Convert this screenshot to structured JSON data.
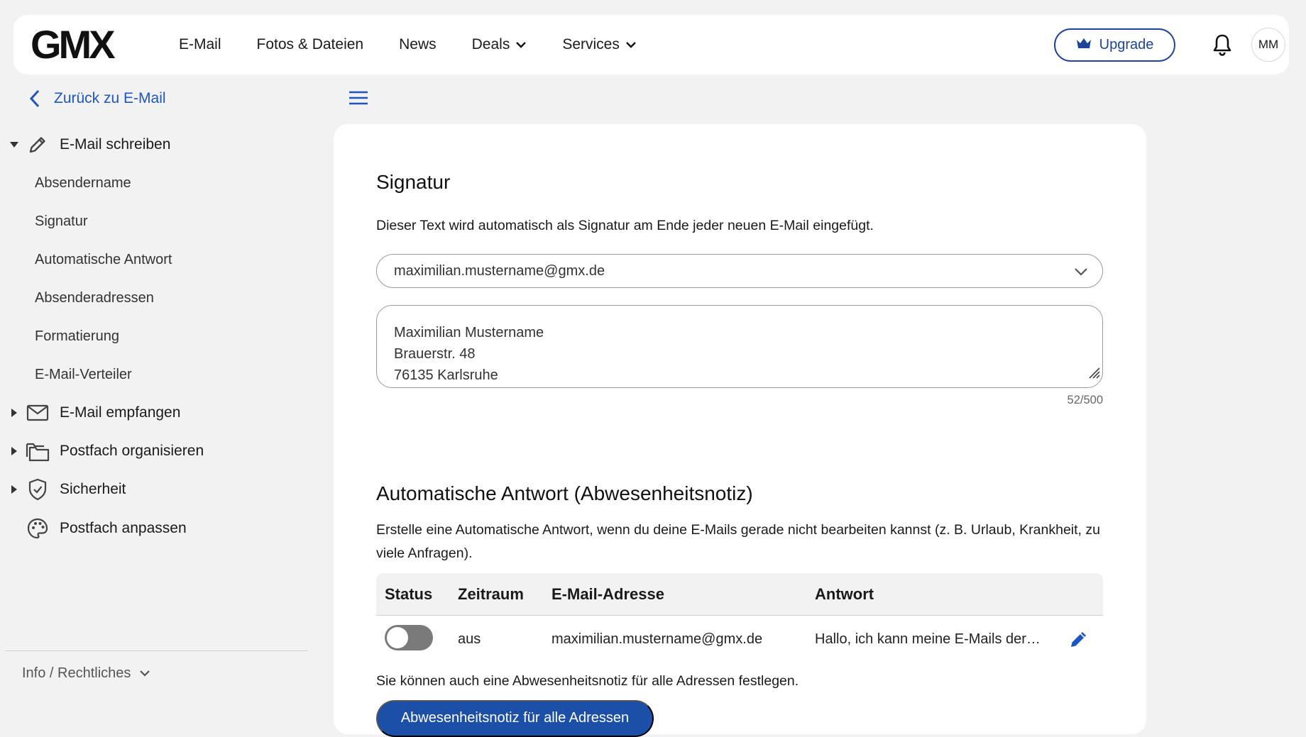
{
  "brand": {
    "logo_text": "GMX",
    "accent": "#1c449b"
  },
  "header": {
    "nav": [
      {
        "label": "E-Mail",
        "dropdown": false
      },
      {
        "label": "Fotos & Dateien",
        "dropdown": false
      },
      {
        "label": "News",
        "dropdown": false
      },
      {
        "label": "Deals",
        "dropdown": true
      },
      {
        "label": "Services",
        "dropdown": true
      }
    ],
    "upgrade_label": "Upgrade",
    "avatar_initials": "MM"
  },
  "sidebar": {
    "back_label": "Zurück zu E-Mail",
    "groups": [
      {
        "label": "E-Mail schreiben",
        "icon": "pencil-icon",
        "expanded": true,
        "items": [
          "Absendername",
          "Signatur",
          "Automatische Antwort",
          "Absenderadressen",
          "Formatierung",
          "E-Mail-Verteiler"
        ]
      },
      {
        "label": "E-Mail empfangen",
        "icon": "envelope-icon",
        "expanded": false
      },
      {
        "label": "Postfach organisieren",
        "icon": "folders-icon",
        "expanded": false
      },
      {
        "label": "Sicherheit",
        "icon": "shield-icon",
        "expanded": false
      },
      {
        "label": "Postfach anpassen",
        "icon": "palette-icon",
        "expanded": false
      }
    ],
    "info_label": "Info / Rechtliches"
  },
  "signature": {
    "title": "Signatur",
    "description": "Dieser Text wird automatisch als Signatur am Ende jeder neuen E-Mail eingefügt.",
    "selected_address": "maximilian.mustername@gmx.de",
    "lines": [
      "Maximilian Mustername",
      "Brauerstr. 48",
      "76135 Karlsruhe"
    ],
    "counter": "52/500"
  },
  "autoreply": {
    "title": "Automatische Antwort (Abwesenheitsnotiz)",
    "description": "Erstelle eine Automatische Antwort, wenn du deine E-Mails gerade nicht bearbeiten kannst (z. B. Urlaub, Krankheit, zu viele Anfragen).",
    "columns": [
      "Status",
      "Zeitraum",
      "E-Mail-Adresse",
      "Antwort"
    ],
    "rows": [
      {
        "status_on": false,
        "period": "aus",
        "address": "maximilian.mustername@gmx.de",
        "reply": "Hallo, ich kann meine E-Mails der…"
      }
    ],
    "hint": "Sie können auch eine Abwesenheitsnotiz für alle Adressen festlegen.",
    "cta_label": "Abwesenheitsnotiz für alle Adressen"
  }
}
